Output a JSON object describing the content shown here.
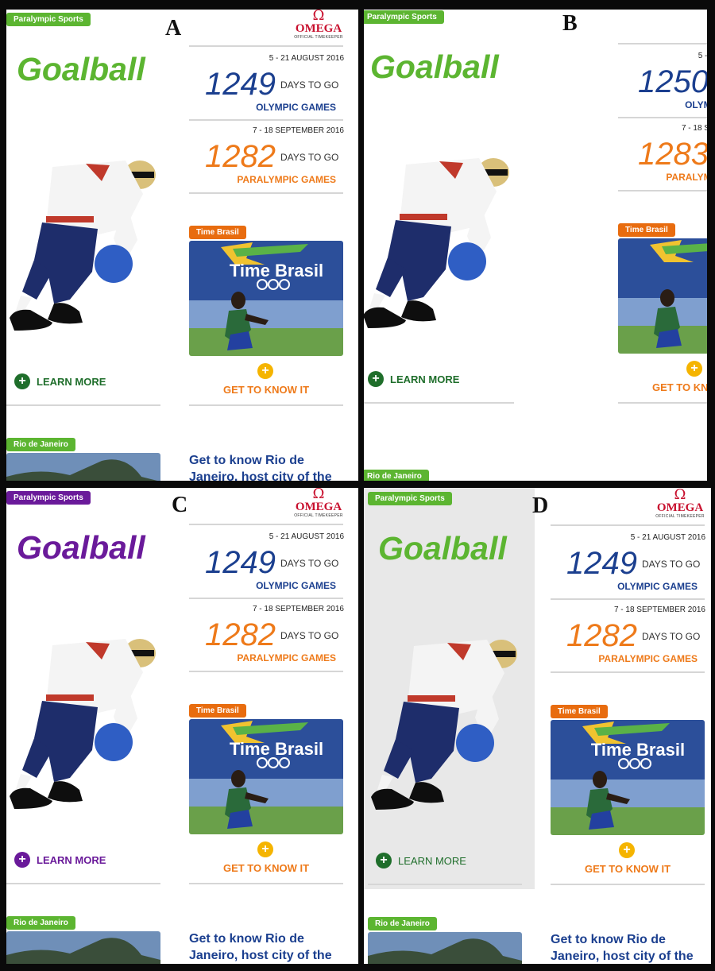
{
  "labels": {
    "a": "A",
    "b": "B",
    "c": "C",
    "d": "D"
  },
  "tags": {
    "sport": "Paralympic Sports",
    "rio": "Rio de Janeiro",
    "brasil": "Time Brasil"
  },
  "title": "Goalball",
  "omega": {
    "symbol": "Ω",
    "name": "OMEGA",
    "sub": "OFFICIAL TIMEKEEPER"
  },
  "olympic": {
    "date": "5 - 21 AUGUST 2016",
    "count": "1249",
    "count_b": "1250",
    "dtg": "DAYS TO GO",
    "name": "OLYMPIC GAMES"
  },
  "paralympic": {
    "date": "7 - 18 SEPTEMBER 2016",
    "count": "1282",
    "count_b": "1283",
    "dtg": "DAYS TO GO",
    "name": "PARALYMPIC GAMES"
  },
  "learn_more": "LEARN MORE",
  "get_to_know": "GET TO KNOW IT",
  "plus": "+",
  "rio_headline": "Get to know Rio de Janeiro, host city of the",
  "colors": {
    "green": "#5cb531",
    "dark_green": "#1f6e2b",
    "purple": "#6a1a9a",
    "blue": "#1b3f8f",
    "orange": "#ee7a1a",
    "omega_red": "#c8102e"
  }
}
